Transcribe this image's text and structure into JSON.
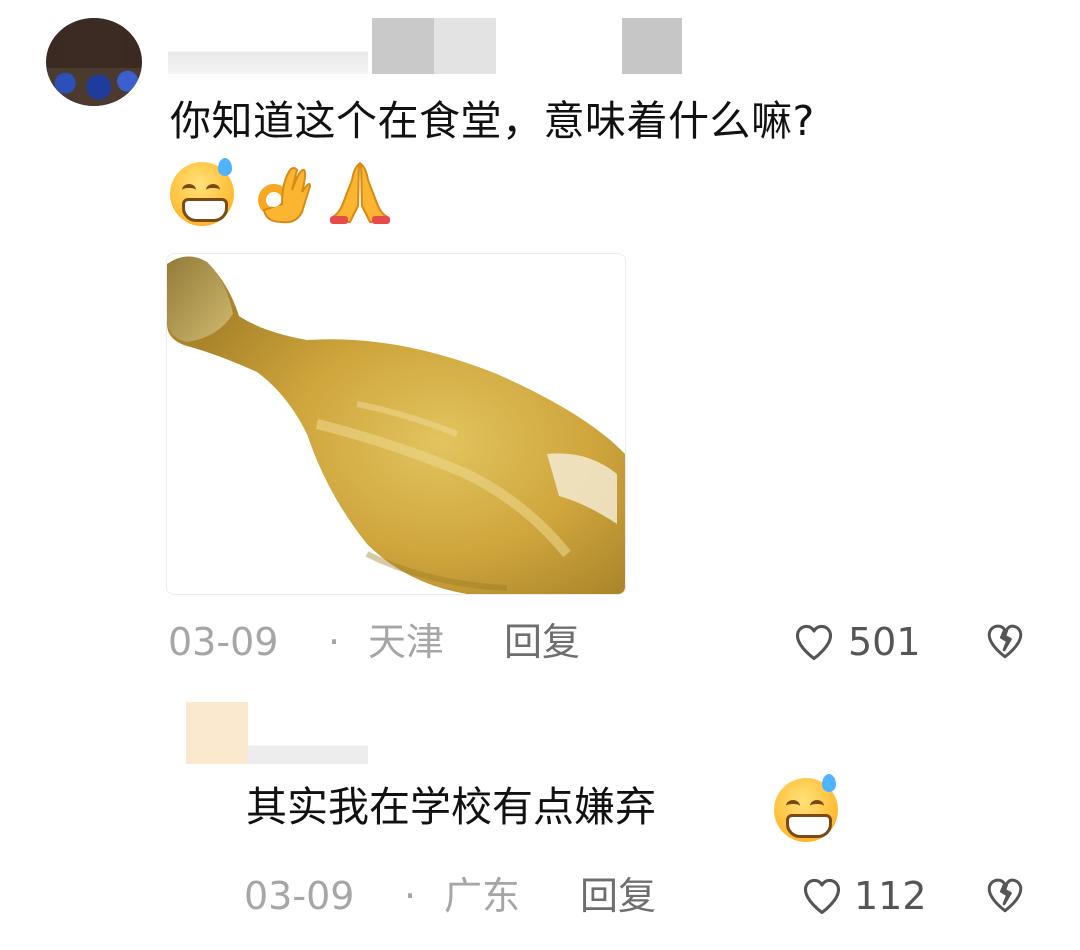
{
  "comments": [
    {
      "text": "你知道这个在食堂，意味着什么嘛?",
      "emojis": [
        "grinning-sweat-emoji",
        "ok-hand-emoji",
        "folded-hands-emoji"
      ],
      "image": "chicken-drumstick-photo",
      "date": "03-09",
      "separator": "·",
      "location": "天津",
      "reply_label": "回复",
      "likes": "501"
    },
    {
      "text": "其实我在学校有点嫌弃",
      "emojis": [
        "grinning-sweat-emoji"
      ],
      "date": "03-09",
      "separator": "·",
      "location": "广东",
      "reply_label": "回复",
      "likes": "112"
    }
  ],
  "colors": {
    "meta_gray": "#a6a6a6",
    "reply_gray": "#6e6e6e",
    "like_gray": "#555555",
    "emoji_yellow": "#ffb92e"
  }
}
